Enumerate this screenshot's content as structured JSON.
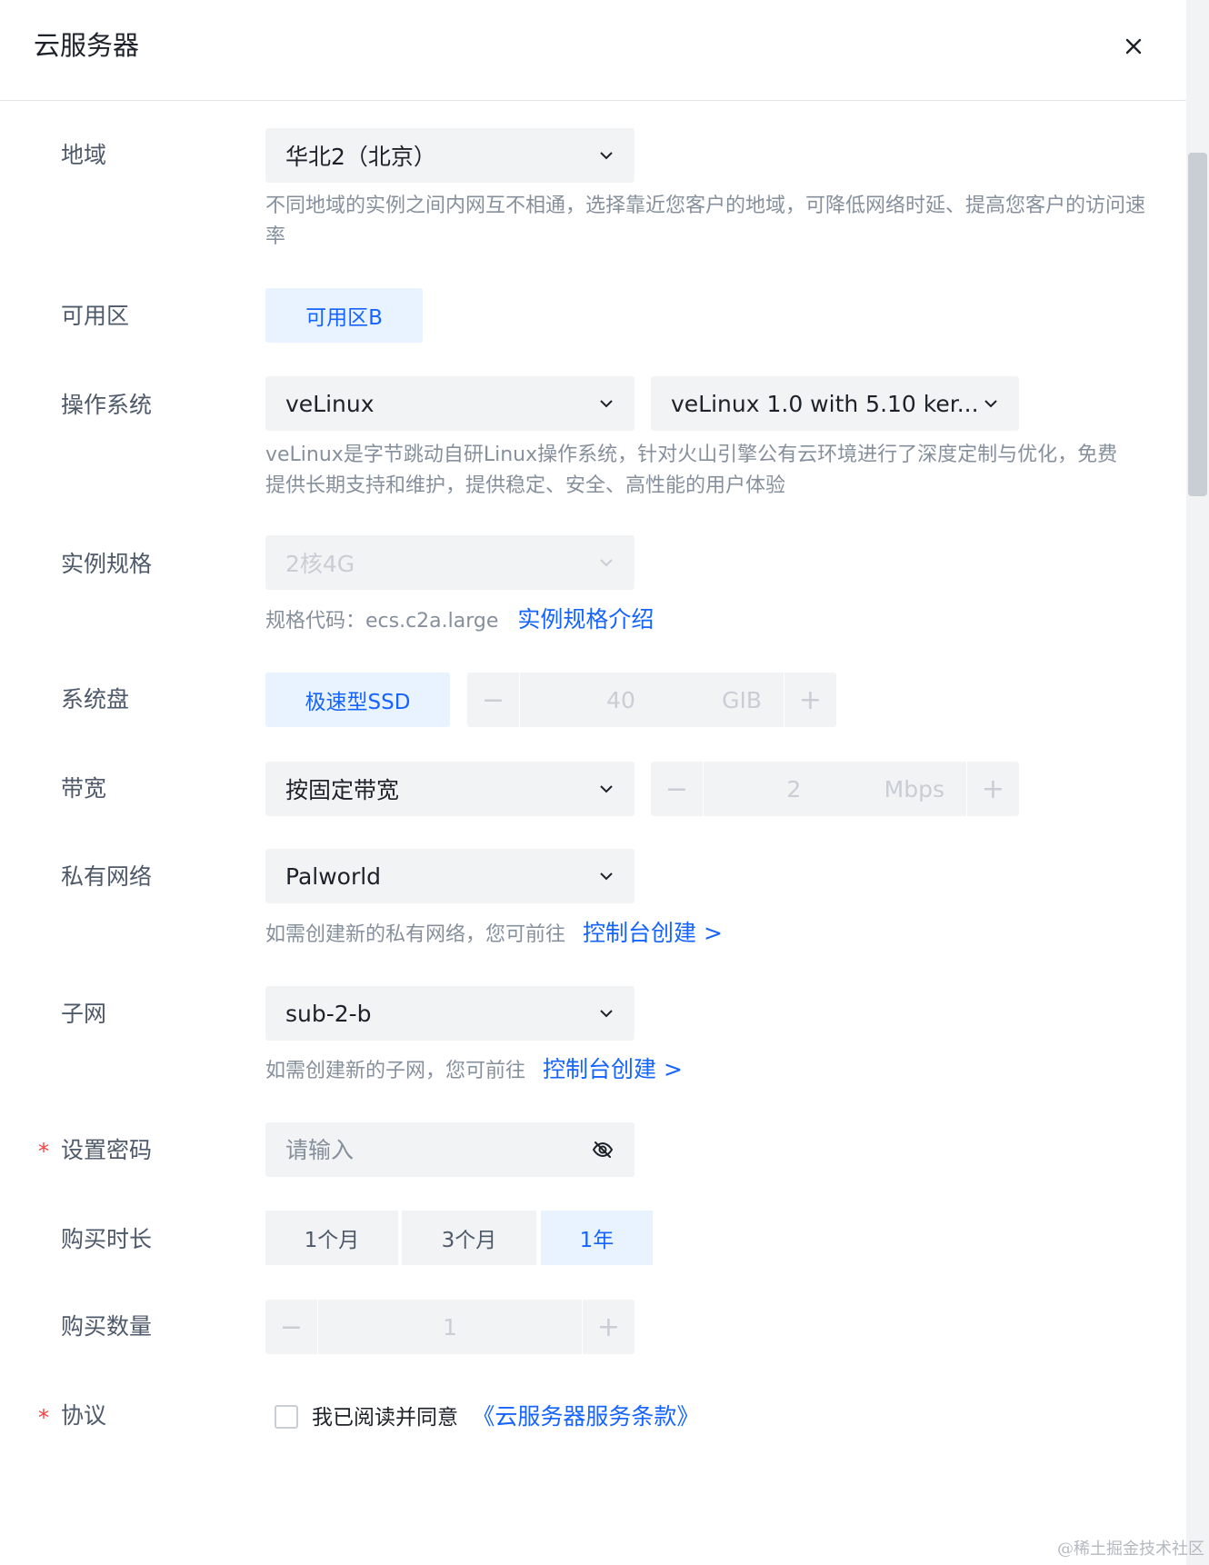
{
  "header": {
    "title": "云服务器"
  },
  "icons": {
    "close": "close-icon",
    "chevron": "chevron-down-icon",
    "eye": "eye-off-icon"
  },
  "region": {
    "label": "地域",
    "value": "华北2（北京）",
    "hint": "不同地域的实例之间内网互不相通，选择靠近您客户的地域，可降低网络时延、提高您客户的访问速率"
  },
  "zone": {
    "label": "可用区",
    "value": "可用区B"
  },
  "os": {
    "label": "操作系统",
    "value": "veLinux",
    "version": "veLinux 1.0 with 5.10 ker...",
    "hint_line1": "veLinux是字节跳动自研Linux操作系统，针对火山引擎公有云环境进行了深度定制与优化，免费",
    "hint_line2": "提供长期支持和维护，提供稳定、安全、高性能的用户体验"
  },
  "instance": {
    "label": "实例规格",
    "value": "2核4G",
    "hint": "规格代码：ecs.c2a.large",
    "link": "实例规格介绍"
  },
  "disk": {
    "label": "系统盘",
    "type": "极速型SSD",
    "size": "40",
    "unit": "GIB",
    "minus": "−",
    "plus": "+"
  },
  "bandwidth": {
    "label": "带宽",
    "mode": "按固定带宽",
    "value": "2",
    "unit": "Mbps",
    "minus": "−",
    "plus": "+"
  },
  "vpc": {
    "label": "私有网络",
    "value": "Palworld",
    "hint": "如需创建新的私有网络，您可前往",
    "link": "控制台创建 >"
  },
  "subnet": {
    "label": "子网",
    "value": "sub-2-b",
    "hint": "如需创建新的子网，您可前往",
    "link": "控制台创建 >"
  },
  "password": {
    "required": "*",
    "label": "设置密码",
    "placeholder": "请输入"
  },
  "duration": {
    "label": "购买时长",
    "options": [
      "1个月",
      "3个月",
      "1年"
    ],
    "selected": "1年"
  },
  "quantity": {
    "label": "购买数量",
    "value": "1",
    "minus": "−",
    "plus": "+"
  },
  "agreement": {
    "required": "*",
    "label": "协议",
    "text": "我已阅读并同意",
    "link": "《云服务器服务条款》"
  },
  "watermark": "@稀土掘金技术社区",
  "colors": {
    "primary": "#1664ff",
    "fill": "#f2f3f5",
    "active_fill": "#e8f3ff",
    "required": "#f53f3f"
  }
}
